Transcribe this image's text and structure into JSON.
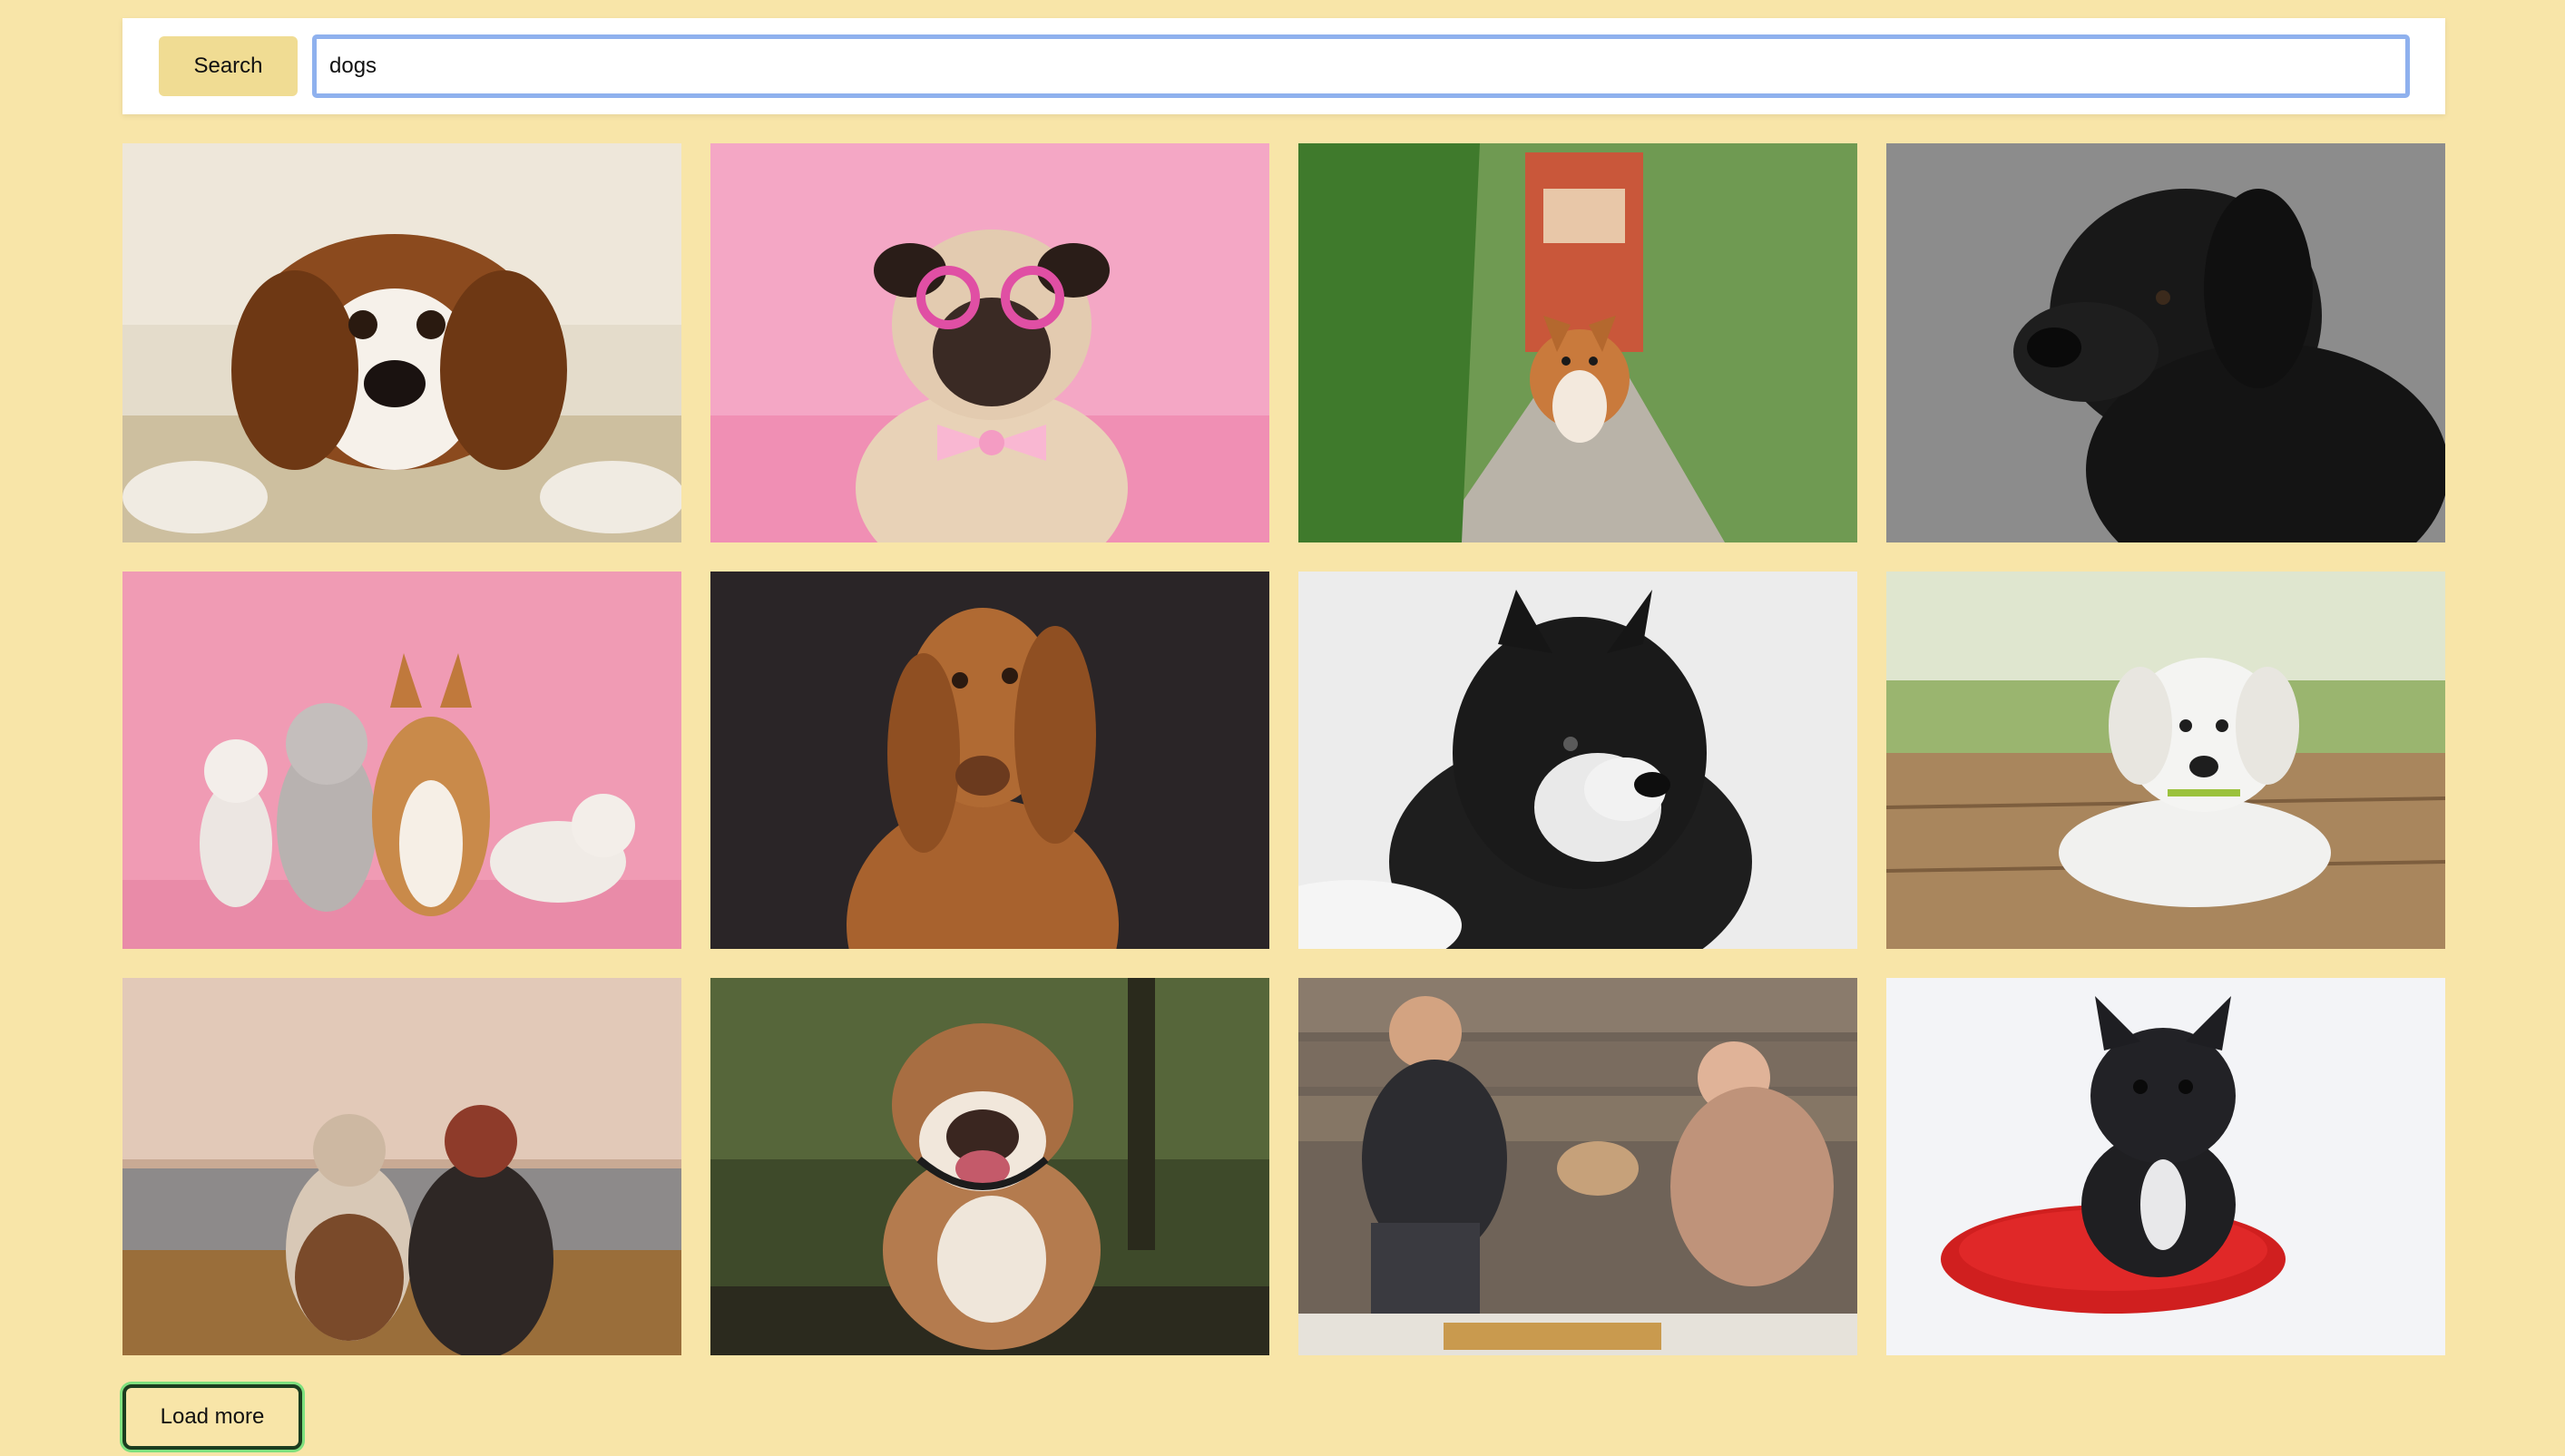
{
  "search": {
    "button_label": "Search",
    "value": "dogs"
  },
  "gallery": {
    "images": [
      {
        "name": "cavalier-spaniel-photo",
        "bg": "#d9cdb6",
        "accent": "#8b4a1e"
      },
      {
        "name": "pug-with-glasses-photo",
        "bg": "#f3a3c3",
        "accent": "#e8d2b7"
      },
      {
        "name": "corgi-on-tracks-photo",
        "bg": "#5f8a45",
        "accent": "#c97a3c"
      },
      {
        "name": "black-labrador-photo",
        "bg": "#8c8c8c",
        "accent": "#1a1a1a"
      },
      {
        "name": "dogs-and-cats-pink-photo",
        "bg": "#f09bb4",
        "accent": "#c98a4a"
      },
      {
        "name": "vizsla-dark-background-photo",
        "bg": "#2a2527",
        "accent": "#a8622e"
      },
      {
        "name": "husky-black-white-photo",
        "bg": "#e6e6e6",
        "accent": "#1f1f1f"
      },
      {
        "name": "white-puppy-photo",
        "bg": "#8fa36a",
        "accent": "#ececec"
      },
      {
        "name": "dog-and-woman-lake-photo",
        "bg": "#b59a86",
        "accent": "#3b2c2a"
      },
      {
        "name": "bulldog-forest-photo",
        "bg": "#3e4a2a",
        "accent": "#9a6a42"
      },
      {
        "name": "couple-with-pug-photo",
        "bg": "#6f6358",
        "accent": "#2c2c30"
      },
      {
        "name": "french-bulldog-pillow-photo",
        "bg": "#f2f3f6",
        "accent": "#1f1f22"
      }
    ]
  },
  "footer": {
    "load_more_label": "Load more"
  }
}
